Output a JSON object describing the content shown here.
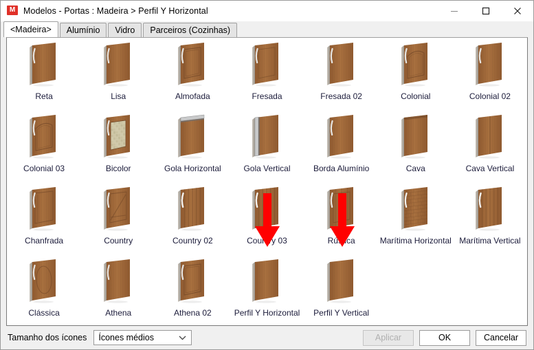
{
  "window": {
    "title": "Modelos - Portas : Madeira > Perfil Y Horizontal",
    "app_icon": "M",
    "minimize_label": "Minimizar",
    "maximize_label": "Maximizar",
    "close_label": "Fechar"
  },
  "tabs": [
    {
      "label": "<Madeira>",
      "active": true
    },
    {
      "label": "Alumínio",
      "active": false
    },
    {
      "label": "Vidro",
      "active": false
    },
    {
      "label": "Parceiros (Cozinhas)",
      "active": false
    }
  ],
  "items": [
    {
      "label": "Reta",
      "style": "plain"
    },
    {
      "label": "Lisa",
      "style": "plain"
    },
    {
      "label": "Almofada",
      "style": "raised-panel"
    },
    {
      "label": "Fresada",
      "style": "routed"
    },
    {
      "label": "Fresada 02",
      "style": "plain"
    },
    {
      "label": "Colonial",
      "style": "arch-panel"
    },
    {
      "label": "Colonial 02",
      "style": "plain"
    },
    {
      "label": "Colonial 03",
      "style": "arch-panel"
    },
    {
      "label": "Bicolor",
      "style": "bicolor"
    },
    {
      "label": "Gola Horizontal",
      "style": "gola-h"
    },
    {
      "label": "Gola Vertical",
      "style": "gola-v"
    },
    {
      "label": "Borda Alumínio",
      "style": "plain"
    },
    {
      "label": "Cava",
      "style": "cava"
    },
    {
      "label": "Cava Vertical",
      "style": "cava-v"
    },
    {
      "label": "Chanfrada",
      "style": "chamfer"
    },
    {
      "label": "Country",
      "style": "country"
    },
    {
      "label": "Country 02",
      "style": "slats-v"
    },
    {
      "label": "Country 03",
      "style": "slats-v"
    },
    {
      "label": "Rústica",
      "style": "rustic"
    },
    {
      "label": "Marítima Horizontal",
      "style": "brick-h"
    },
    {
      "label": "Marítima Vertical",
      "style": "slats-v"
    },
    {
      "label": "Clássica",
      "style": "oval-panel"
    },
    {
      "label": "Athena",
      "style": "plain"
    },
    {
      "label": "Athena 02",
      "style": "inset-panel"
    },
    {
      "label": "Perfil Y Horizontal",
      "style": "nohandle"
    },
    {
      "label": "Perfil Y Vertical",
      "style": "nohandle"
    }
  ],
  "annotations": [
    {
      "name": "arrow-country-03",
      "target_index": 17,
      "color": "#FF0000",
      "direction": "down"
    },
    {
      "name": "arrow-rustica",
      "target_index": 18,
      "color": "#FF0000",
      "direction": "down"
    }
  ],
  "footer": {
    "icon_size_label": "Tamanho dos ícones",
    "icon_size_value": "Ícones médios",
    "apply_label": "Aplicar",
    "apply_disabled": true,
    "ok_label": "OK",
    "cancel_label": "Cancelar"
  },
  "colors": {
    "wood_light": "#A8703F",
    "wood_mid": "#8F5A30",
    "wood_dark": "#6E4526",
    "wood_edge": "#C9C3BA",
    "handle": "#F2F2F0",
    "panel_cream": "#D9D2B4",
    "annotation_red": "#FF0000",
    "label_text": "#1b1b3a",
    "dialog_bg": "#f0f0f0"
  }
}
